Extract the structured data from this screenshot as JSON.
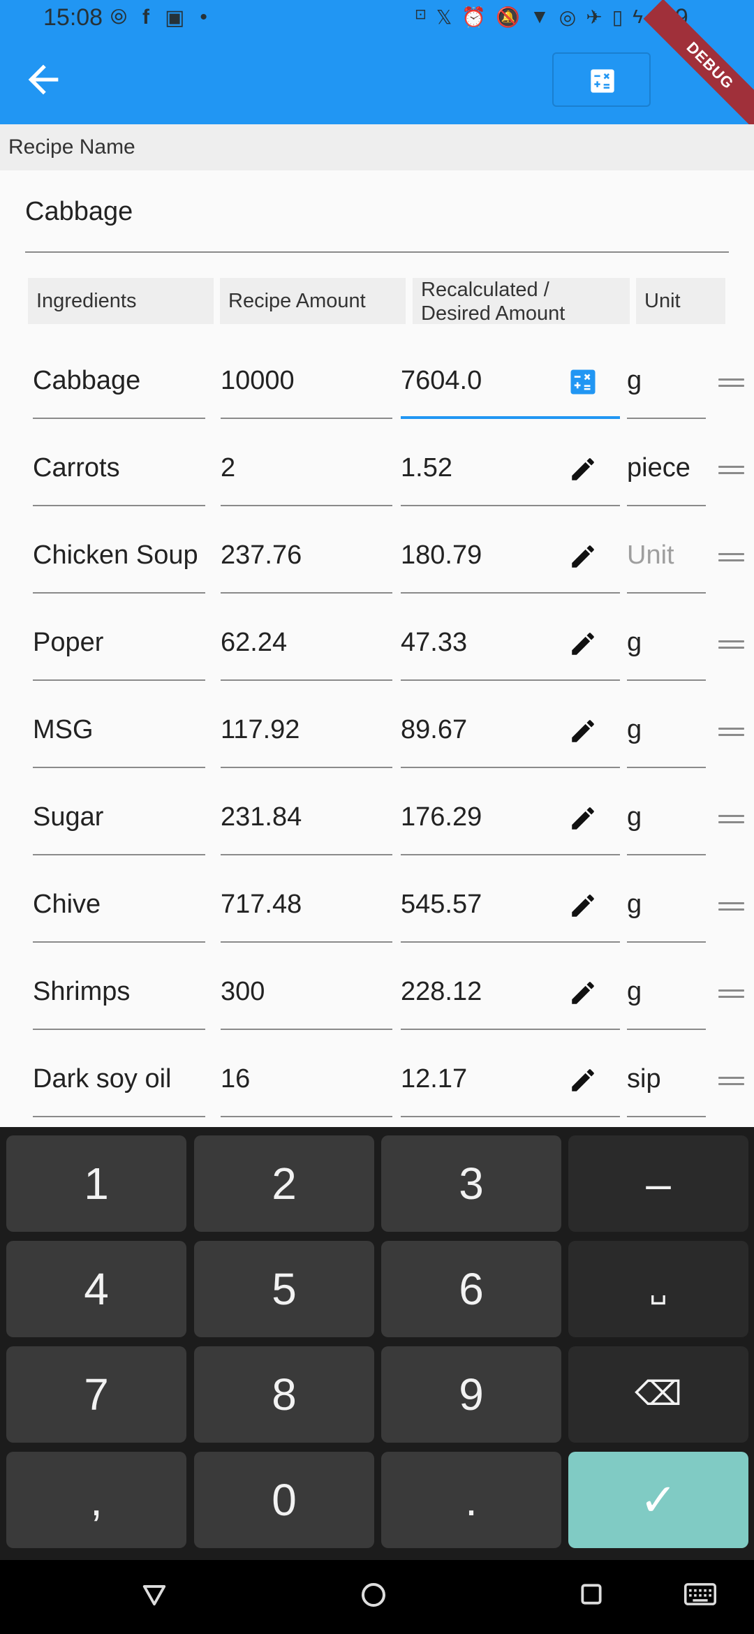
{
  "status_bar": {
    "time": "15:08",
    "battery_text": "29"
  },
  "app_bar": {
    "back_icon": "arrow-back-icon",
    "calc_icon": "calculator-icon",
    "debug_banner": "DEBUG"
  },
  "recipe": {
    "name_label": "Recipe Name",
    "name_value": "Cabbage"
  },
  "columns": {
    "ingredients": "Ingredients",
    "recipe_amount": "Recipe Amount",
    "recalculated": "Recalculated / Desired Amount",
    "unit": "Unit"
  },
  "rows": [
    {
      "ingredient": "Cabbage",
      "amount": "10000",
      "recalculated": "7604.0",
      "unit": "g",
      "unit_placeholder": false,
      "focused": true
    },
    {
      "ingredient": "Carrots",
      "amount": "2",
      "recalculated": "1.52",
      "unit": "piece",
      "unit_placeholder": false,
      "focused": false
    },
    {
      "ingredient": "Chicken Soup",
      "amount": "237.76",
      "recalculated": "180.79",
      "unit": "Unit",
      "unit_placeholder": true,
      "focused": false
    },
    {
      "ingredient": "Poper",
      "amount": "62.24",
      "recalculated": "47.33",
      "unit": "g",
      "unit_placeholder": false,
      "focused": false
    },
    {
      "ingredient": "MSG",
      "amount": "117.92",
      "recalculated": "89.67",
      "unit": "g",
      "unit_placeholder": false,
      "focused": false
    },
    {
      "ingredient": "Sugar",
      "amount": "231.84",
      "recalculated": "176.29",
      "unit": "g",
      "unit_placeholder": false,
      "focused": false
    },
    {
      "ingredient": "Chive",
      "amount": "717.48",
      "recalculated": "545.57",
      "unit": "g",
      "unit_placeholder": false,
      "focused": false
    },
    {
      "ingredient": "Shrimps",
      "amount": "300",
      "recalculated": "228.12",
      "unit": "g",
      "unit_placeholder": false,
      "focused": false
    },
    {
      "ingredient": "Dark soy oil",
      "amount": "16",
      "recalculated": "12.17",
      "unit": "sip",
      "unit_placeholder": false,
      "focused": false
    }
  ],
  "keyboard": {
    "keys": [
      [
        "1",
        "2",
        "3",
        "–"
      ],
      [
        "4",
        "5",
        "6",
        "␣"
      ],
      [
        "7",
        "8",
        "9",
        "⌫"
      ],
      [
        ",",
        "0",
        ".",
        "✓"
      ]
    ]
  },
  "colors": {
    "primary": "#2196f3",
    "keyboard_bg": "#1c1c1c",
    "key_bg": "#3a3a3a",
    "done_key": "#80cbc4"
  }
}
